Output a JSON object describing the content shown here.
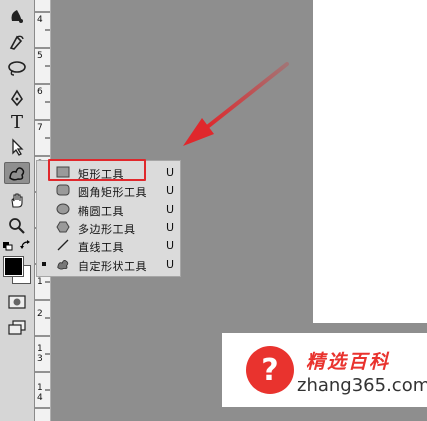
{
  "toolbar": {
    "tools": [
      {
        "name": "burn-tool-icon"
      },
      {
        "name": "pen-freeform-icon"
      },
      {
        "name": "lasso-icon"
      },
      {
        "name": "pen-tool-icon"
      },
      {
        "name": "type-tool-icon",
        "glyph": "T"
      },
      {
        "name": "path-selection-icon"
      },
      {
        "name": "custom-shape-tool-icon",
        "active": true
      },
      {
        "name": "hand-tool-icon"
      },
      {
        "name": "zoom-tool-icon"
      }
    ],
    "foreground_color": "#000000",
    "background_color": "#ffffff"
  },
  "ruler": {
    "labels": [
      "4",
      "5",
      "6",
      "7",
      "8",
      "9",
      "1",
      "1",
      "1",
      "2",
      "1",
      "3",
      "1",
      "4"
    ]
  },
  "shape_menu": {
    "items": [
      {
        "icon": "rectangle-icon",
        "label": "矩形工具",
        "shortcut": "U",
        "highlighted": true
      },
      {
        "icon": "rounded-rectangle-icon",
        "label": "圆角矩形工具",
        "shortcut": "U"
      },
      {
        "icon": "ellipse-icon",
        "label": "椭圆工具",
        "shortcut": "U"
      },
      {
        "icon": "polygon-icon",
        "label": "多边形工具",
        "shortcut": "U"
      },
      {
        "icon": "line-icon",
        "label": "直线工具",
        "shortcut": "U"
      },
      {
        "icon": "custom-shape-icon",
        "label": "自定形状工具",
        "shortcut": "U",
        "current": true
      }
    ]
  },
  "annotation": {
    "highlight_color": "#e0282c",
    "arrow_color": "#e0282c"
  },
  "watermark": {
    "title": "精选百科",
    "domain": "zhang365.com",
    "accent": "#e9332e"
  }
}
